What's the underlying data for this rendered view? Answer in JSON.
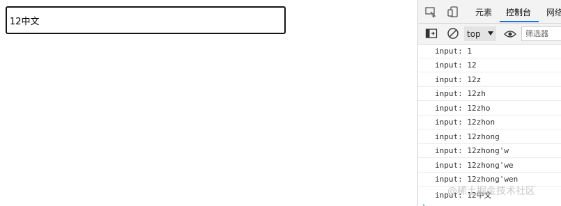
{
  "input": {
    "value": "12中文"
  },
  "devtools": {
    "tabs": [
      {
        "label": "元素"
      },
      {
        "label": "控制台"
      },
      {
        "label": "网络"
      }
    ],
    "toolbar": {
      "context": "top",
      "filter_placeholder": "筛选器"
    },
    "console_lines": [
      "input: 1",
      "input: 12",
      "input: 12z",
      "input: 12zh",
      "input: 12zho",
      "input: 12zhon",
      "input: 12zhong",
      "input: 12zhong'w",
      "input: 12zhong'we",
      "input: 12zhong'wen",
      "input: 12中文"
    ]
  },
  "watermark": "@稀土掘金技术社区",
  "colors": {
    "accent": "#1a73e8",
    "input_border": "#141414"
  }
}
